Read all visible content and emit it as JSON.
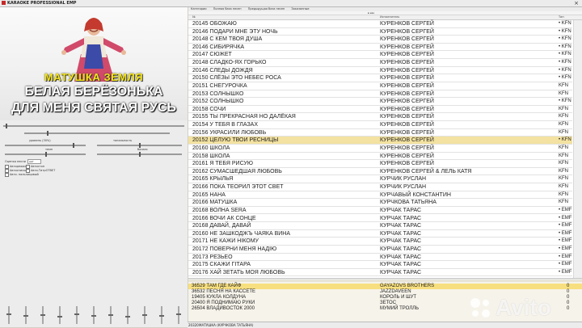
{
  "window": {
    "title": "KARAOKE PROFESSIONAL EMP",
    "close_glyph": "×"
  },
  "video": {
    "song_title": "МАТУШКА ЗЕМЛЯ",
    "lyric_line_1": "БЕЛАЯ БЕРЁЗОНЬКА",
    "lyric_line_2": "ДЛЯ МЕНЯ СВЯТАЯ РУСЬ"
  },
  "controls": {
    "level_label": "уровень (30%)",
    "tone_label": "тональность",
    "tempo_label": "темп",
    "balance_label": "баланс",
    "mode_label": "Оценка песни",
    "mode_value": "нет",
    "option_1": "Авторежим",
    "option_2": "Автостоп",
    "option_3": "Автосписки",
    "option_4": "Авто-ТитрОТВЕТ",
    "option_5": "Авто. пальлицовый"
  },
  "tabs": [
    "Категории",
    "Полная база песен",
    "Предыдущая база песен",
    "Заказанные"
  ],
  "filter_text": "в каз",
  "table_headers": [
    "№",
    "Исполнитель",
    "Тип"
  ],
  "songs": [
    {
      "n": "20145",
      "title": "ОБОЖАЮ",
      "artist": "КУРЕНКОВ СЕРГЕЙ",
      "t": "• KFN"
    },
    {
      "n": "20146",
      "title": "ПОДАРИ МНЕ ЭТУ НОЧЬ",
      "artist": "КУРЕНКОВ СЕРГЕЙ",
      "t": "• KFN"
    },
    {
      "n": "20148",
      "title": "С КЕМ ТВОЯ ДУША",
      "artist": "КУРЕНКОВ СЕРГЕЙ",
      "t": "• KFN"
    },
    {
      "n": "20146",
      "title": "СИБИРЯЧКА",
      "artist": "КУРЕНКОВ СЕРГЕЙ",
      "t": "• KFN"
    },
    {
      "n": "20147",
      "title": "СЮЖЕТ",
      "artist": "КУРЕНКОВ СЕРГЕЙ",
      "t": "• KFN"
    },
    {
      "n": "20148",
      "title": "СЛАДКО-ЯХ ГОРЬКО",
      "artist": "КУРЕНКОВ СЕРГЕЙ",
      "t": "• KFN"
    },
    {
      "n": "20146",
      "title": "СЛЕДЫ ДОЖДЯ",
      "artist": "КУРЕНКОВ СЕРГЕЙ",
      "t": "• KFN"
    },
    {
      "n": "20150",
      "title": "СЛЁЗЫ ЭТО НЕБЕС РОСА",
      "artist": "КУРЕНКОВ СЕРГЕЙ",
      "t": "• KFN"
    },
    {
      "n": "20151",
      "title": "СНЕГУРОЧКА",
      "artist": "КУРЕНКОВ СЕРГЕЙ",
      "t": "KFN"
    },
    {
      "n": "20153",
      "title": "СОЛНЫШКО",
      "artist": "КУРЕНКОВ СЕРГЕЙ",
      "t": "KFN"
    },
    {
      "n": "20152",
      "title": "СОЛНЫШКО",
      "artist": "КУРЕНКОВ СЕРГЕЙ",
      "t": "• KFN"
    },
    {
      "n": "20158",
      "title": "СОЧИ",
      "artist": "КУРЕНКОВ СЕРГЕЙ",
      "t": "KFN"
    },
    {
      "n": "20155",
      "title": "ТЫ ПРЕКРАСНАЯ НО ДАЛЁКАЯ",
      "artist": "КУРЕНКОВ СЕРГЕЙ",
      "t": "KFN"
    },
    {
      "n": "20154",
      "title": "У ТЕБЯ В ГЛАЗАХ",
      "artist": "КУРЕНКОВ СЕРГЕЙ",
      "t": "KFN"
    },
    {
      "n": "20156",
      "title": "УКРАСИЛИ ЛЮБОВЬ",
      "artist": "КУРЕНКОВ СЕРГЕЙ",
      "t": "KFN"
    },
    {
      "n": "20152",
      "title": "ЦЕЛУЮ ТВОИ РЕСНИЦЫ",
      "artist": "КУРЕНКОВ СЕРГЕЙ",
      "t": "• KFN",
      "selected": true
    },
    {
      "n": "20160",
      "title": "ШКОЛА",
      "artist": "КУРЕНКОВ СЕРГЕЙ",
      "t": "KFN"
    },
    {
      "n": "20158",
      "title": "ШКОЛА",
      "artist": "КУРЕНКОВ СЕРГЕЙ",
      "t": "KFN"
    },
    {
      "n": "20161",
      "title": "Я ТЕБЯ РИСУЮ",
      "artist": "КУРЕНКОВ СЕРГЕЙ",
      "t": "KFN"
    },
    {
      "n": "20162",
      "title": "СУМАСШЕДШАЯ ЛЮБОВЬ",
      "artist": "КУРЕНКОВ СЕРГЕЙ & ЛЕЛЬ КАТЯ",
      "t": "KFN"
    },
    {
      "n": "20165",
      "title": "КРЫЛЬЯ",
      "artist": "КУРЧИК РУСЛАН",
      "t": "KFN"
    },
    {
      "n": "20166",
      "title": "ПОКА ТЕОРИЛ ЭТОТ СВЕТ",
      "artist": "КУРЧИК РУСЛАН",
      "t": "KFN"
    },
    {
      "n": "20165",
      "title": "НАНА",
      "artist": "КУРЧАВЫЙ КОНСТАНТИН",
      "t": "KFN"
    },
    {
      "n": "20166",
      "title": "МАТУШКА",
      "artist": "КУРЧКОВА ТАТЬЯНА",
      "t": "KFN"
    },
    {
      "n": "20168",
      "title": "ВОЛНА SERA",
      "artist": "КУРЧАК ТАРАС",
      "t": "• EMF"
    },
    {
      "n": "20166",
      "title": "ВОЧИ АК СОНЦЕ",
      "artist": "КУРЧАК ТАРАС",
      "t": "• EMF"
    },
    {
      "n": "20168",
      "title": "ДАВАЙ, ДАВАЙ",
      "artist": "КУРЧАК ТАРАС",
      "t": "• EMF"
    },
    {
      "n": "20160",
      "title": "НЕ ЗАШКОДЖЪ ЧАЯКА ВИНА",
      "artist": "КУРЧАК ТАРАС",
      "t": "• EMF"
    },
    {
      "n": "20171",
      "title": "НЕ КАЖИ НІКОМУ",
      "artist": "КУРЧАК ТАРАС",
      "t": "• EMF"
    },
    {
      "n": "20172",
      "title": "ПОВЕРНИ МЕНЯ НАДІЮ",
      "artist": "КУРЧАК ТАРАС",
      "t": "• EMF"
    },
    {
      "n": "20173",
      "title": "РЕЗЬЕО",
      "artist": "КУРЧАК ТАРАС",
      "t": "• EMF"
    },
    {
      "n": "20175",
      "title": "СКАЖИ ГІТАРА",
      "artist": "КУРЧАК ТАРАС",
      "t": "• EMF"
    },
    {
      "n": "20176",
      "title": "ХАЙ ЗЕТАТЬ МОЯ ЛЮБОВЬ",
      "artist": "КУРЧАК ТАРАС",
      "t": "• EMF"
    }
  ],
  "queue": [
    {
      "n": "36529",
      "title": "ТАМ ГДЕ КАЙФ",
      "artist": "GAYAZOVS BROTHERS",
      "c": "0",
      "selected": true
    },
    {
      "n": "36532",
      "title": "ПЕСНЯ НА КАССЕТЕ",
      "artist": "JAZZDAVEEN",
      "c": "0"
    },
    {
      "n": "19405",
      "title": "КУКЛА КОЛДУНА",
      "artist": "КОРОЛЬ И ШУТ",
      "c": "0"
    },
    {
      "n": "20400",
      "title": "Я ПОДНИМАЮ РУКИ",
      "artist": "ЗЕТОС",
      "c": "0"
    },
    {
      "n": "26504",
      "title": "ВЛАДИВОСТОК 2000",
      "artist": "МУМИЙ ТРОЛЛЬ",
      "c": "0"
    }
  ],
  "status": {
    "count": "20320",
    "now_playing": "МАТУШКА (КУРЧКОВА ТАТЬЯНА)"
  },
  "watermark": "Avito"
}
